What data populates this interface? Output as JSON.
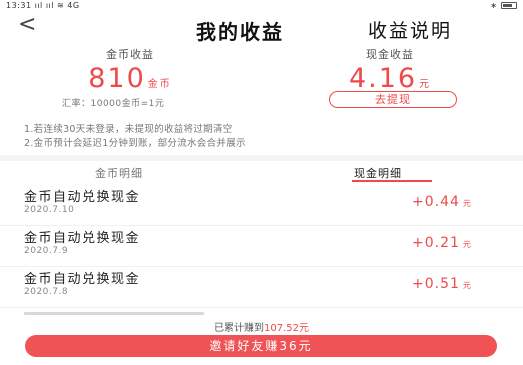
{
  "status_bar": {
    "time": "13:31",
    "signal": "ııl ııl ≋ ",
    "network": "4G",
    "right_icons": "∗"
  },
  "nav": {
    "back": "<",
    "title": "我的收益",
    "right_link": "收益说明"
  },
  "summary": {
    "coin": {
      "label": "金币收益",
      "value": "810",
      "unit": "金币"
    },
    "cash": {
      "label": "现金收益",
      "value": "4.16",
      "unit": "元"
    },
    "rate": "汇率：10000金币=1元",
    "withdraw_label": "去提现"
  },
  "notes": [
    "1.若连续30天未登录，未提现的收益将过期清空",
    "2.金币预计会延迟1分钟到账，部分流水会合并展示"
  ],
  "tabs": [
    {
      "label": "金币明细",
      "active": false
    },
    {
      "label": "现金明细",
      "active": true
    }
  ],
  "items": [
    {
      "title": "金币自动兑换现金",
      "date": "2020.7.10",
      "amount": "+0.44",
      "unit": "元"
    },
    {
      "title": "金币自动兑换现金",
      "date": "2020.7.9",
      "amount": "+0.21",
      "unit": "元"
    },
    {
      "title": "金币自动兑换现金",
      "date": "2020.7.8",
      "amount": "+0.51",
      "unit": "元"
    }
  ],
  "footer": {
    "total_prefix": "已累计赚到",
    "total_amount": "107.52元",
    "invite_label": "邀请好友赚36元"
  },
  "colors": {
    "accent": "#ee4a4a",
    "button": "#f05356"
  },
  "icons": {
    "back": "chevron-left-icon",
    "signal": "signal-icon",
    "wifi": "wifi-icon",
    "battery": "battery-icon"
  }
}
